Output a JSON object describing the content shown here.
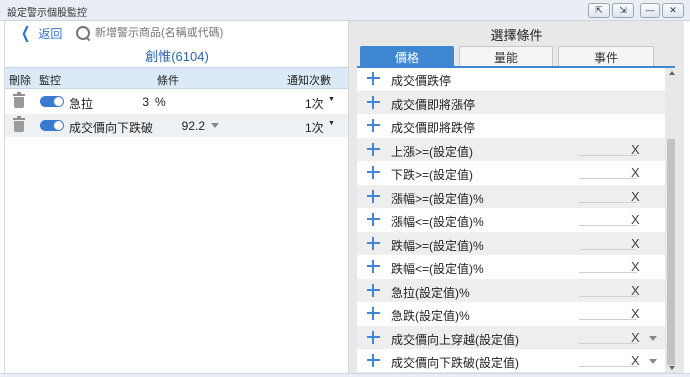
{
  "window": {
    "title": "設定警示個股監控",
    "buttons": [
      "⇱",
      "⇲",
      "—",
      "▢",
      "✕"
    ]
  },
  "left": {
    "back_label": "返回",
    "search": {
      "placeholder": "新增警示商品(名稱或代碼)",
      "value": ""
    },
    "stock_title": "創惟(6104)",
    "headers": {
      "delete": "刪除",
      "monitor": "監控",
      "condition": "條件",
      "frequency": "通知次數"
    },
    "rows": [
      {
        "name": "急拉",
        "value": "3",
        "unit": "%",
        "frequency": "1次",
        "monitor_on": true,
        "has_dropdown": false
      },
      {
        "name": "成交價向下跌破",
        "value": "92.2",
        "unit": "",
        "frequency": "1次",
        "monitor_on": true,
        "has_dropdown": true
      }
    ]
  },
  "right": {
    "title": "選擇條件",
    "tabs": [
      {
        "label": "價格",
        "active": true
      },
      {
        "label": "量能",
        "active": false
      },
      {
        "label": "事件",
        "active": false
      }
    ],
    "items": [
      {
        "label": "成交價跌停",
        "has_x": false,
        "has_dropdown": false
      },
      {
        "label": "成交價即將漲停",
        "has_x": false,
        "has_dropdown": false
      },
      {
        "label": "成交價即將跌停",
        "has_x": false,
        "has_dropdown": false
      },
      {
        "label": "上漲>=(設定值)",
        "has_x": true,
        "x": "X",
        "has_dropdown": false
      },
      {
        "label": "下跌>=(設定值)",
        "has_x": true,
        "x": "X",
        "has_dropdown": false
      },
      {
        "label": "漲幅>=(設定值)%",
        "has_x": true,
        "x": "X",
        "has_dropdown": false
      },
      {
        "label": "漲幅<=(設定值)%",
        "has_x": true,
        "x": "X",
        "has_dropdown": false
      },
      {
        "label": "跌幅>=(設定值)%",
        "has_x": true,
        "x": "X",
        "has_dropdown": false
      },
      {
        "label": "跌幅<=(設定值)%",
        "has_x": true,
        "x": "X",
        "has_dropdown": false
      },
      {
        "label": "急拉(設定值)%",
        "has_x": true,
        "x": "X",
        "has_dropdown": false
      },
      {
        "label": "急跌(設定值)%",
        "has_x": true,
        "x": "X",
        "has_dropdown": false
      },
      {
        "label": "成交價向上穿越(設定值)",
        "has_x": true,
        "x": "X",
        "has_dropdown": true
      },
      {
        "label": "成交價向下跌破(設定值)",
        "has_x": true,
        "x": "X",
        "has_dropdown": true
      }
    ]
  },
  "colors": {
    "accent": "#3f86d3",
    "link": "#2f74c8",
    "header_bg": "#dce9f7",
    "panel_bg": "#e8e8e8"
  }
}
